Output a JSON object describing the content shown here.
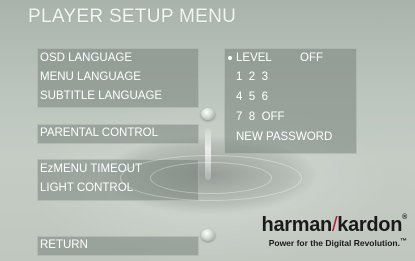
{
  "screen": {
    "title": "PLAYER SETUP MENU"
  },
  "left_menu": {
    "group1": [
      "OSD LANGUAGE",
      "MENU LANGUAGE",
      "SUBTITLE LANGUAGE"
    ],
    "group2": [
      "PARENTAL CONTROL"
    ],
    "group3": [
      "EzMENU TIMEOUT",
      "LIGHT CONTROL"
    ],
    "group4": [
      "RETURN"
    ]
  },
  "right_panel": {
    "level_label": "LEVEL",
    "level_value": "OFF",
    "rows": [
      "1  2  3",
      "4  5  6",
      "7  8  OFF"
    ],
    "new_password": "NEW PASSWORD"
  },
  "brand": {
    "name_left": "harman",
    "separator": "/",
    "name_right": "kardon",
    "registered": "®",
    "tagline": "Power for the Digital Revolution.",
    "tagline_mark": "™"
  },
  "colors": {
    "menu_text": "#ffffff",
    "panel": "#78847c",
    "brand_accent": "#c8102e"
  }
}
